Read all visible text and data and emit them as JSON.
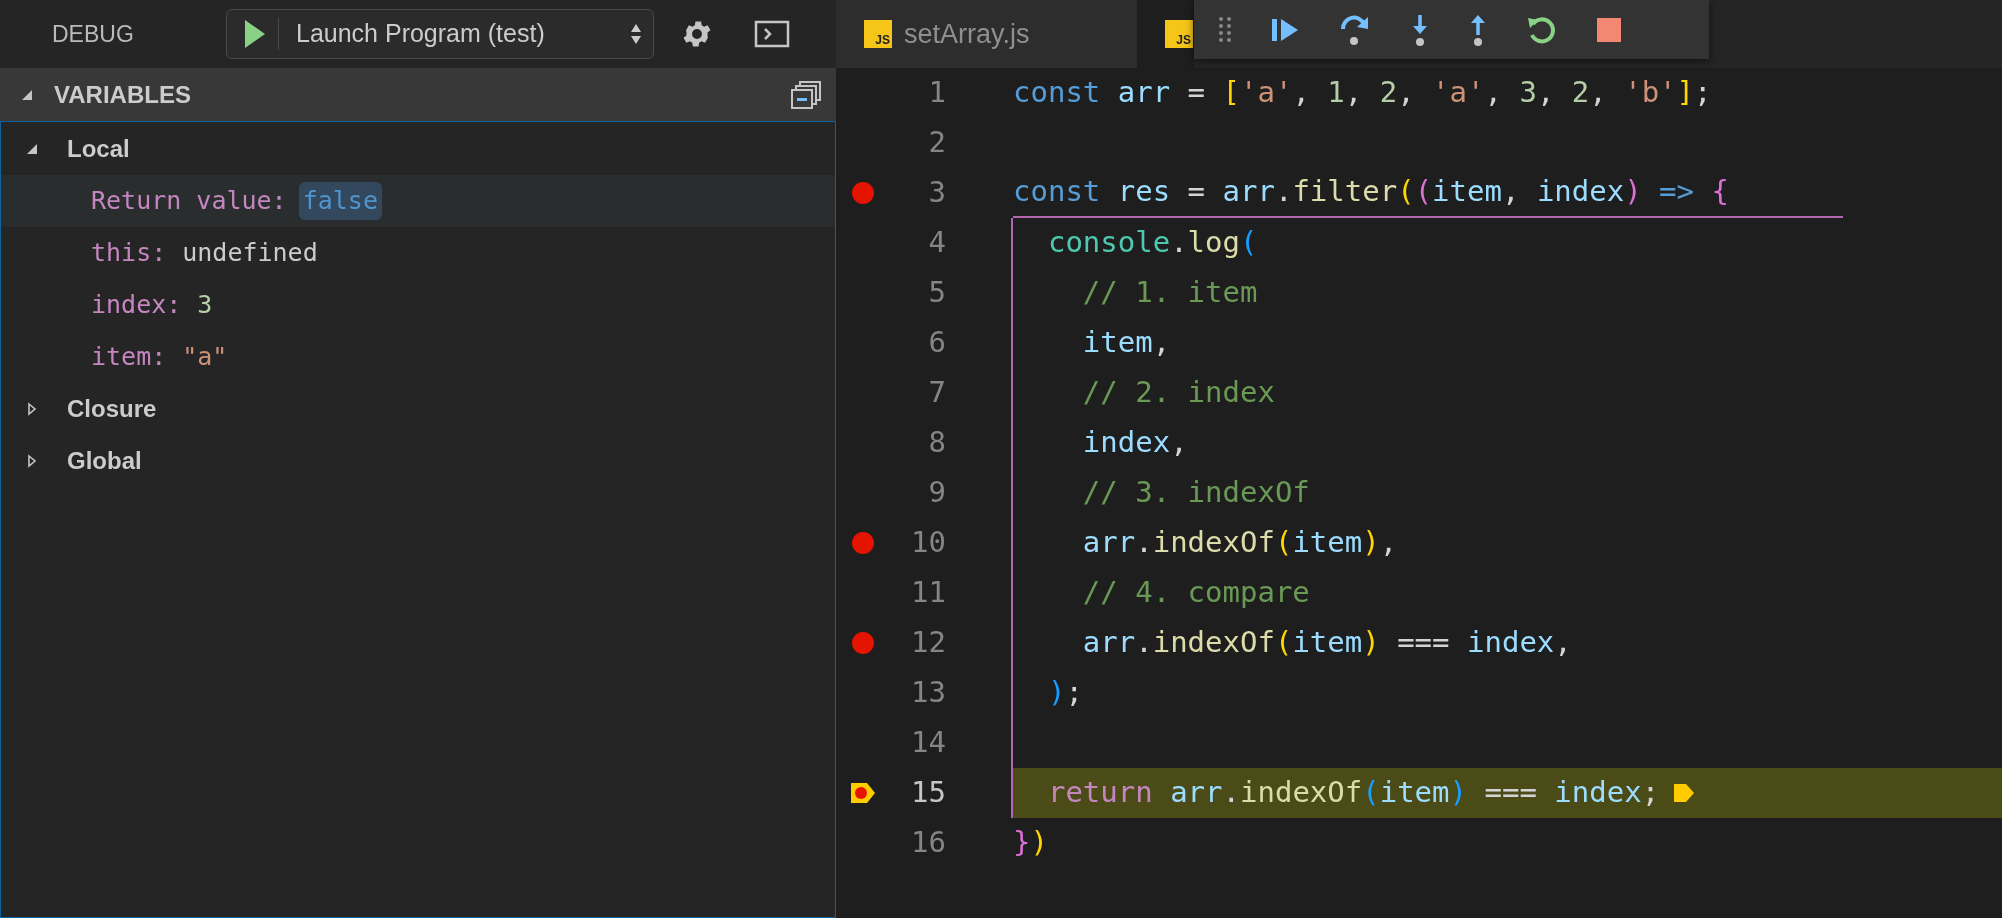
{
  "header": {
    "title": "DEBUG",
    "configuration": "Launch Program (test)"
  },
  "tabs": [
    {
      "label": "setArray.js",
      "icon_text": "JS",
      "selected": false
    },
    {
      "icon_text": "JS",
      "selected": true
    }
  ],
  "variables": {
    "title": "VARIABLES",
    "scopes": [
      {
        "label": "Local",
        "expanded": true,
        "children": [
          {
            "name": "Return value:",
            "value": "false",
            "kind": "boolean",
            "selected": true,
            "changed": true
          },
          {
            "name": "this:",
            "value": "undefined",
            "kind": "undefined",
            "selected": false,
            "changed": false
          },
          {
            "name": "index:",
            "value": "3",
            "kind": "number",
            "selected": false,
            "changed": false
          },
          {
            "name": "item:",
            "value": "\"a\"",
            "kind": "string",
            "selected": false,
            "changed": false
          }
        ]
      },
      {
        "label": "Closure",
        "expanded": false
      },
      {
        "label": "Global",
        "expanded": false
      }
    ]
  },
  "editor": {
    "lines": [
      {
        "number": "1",
        "breakpoint": false,
        "current": false,
        "tokens": [
          {
            "kind": "keyword",
            "text": "const"
          },
          {
            "kind": "variable",
            "text": " arr"
          },
          {
            "kind": "plain",
            "text": " = "
          },
          {
            "kind": "bracket1",
            "text": "["
          },
          {
            "kind": "string",
            "text": "'a'"
          },
          {
            "kind": "plain",
            "text": ", "
          },
          {
            "kind": "number",
            "text": "1"
          },
          {
            "kind": "plain",
            "text": ", "
          },
          {
            "kind": "number",
            "text": "2"
          },
          {
            "kind": "plain",
            "text": ", "
          },
          {
            "kind": "string",
            "text": "'a'"
          },
          {
            "kind": "plain",
            "text": ", "
          },
          {
            "kind": "number",
            "text": "3"
          },
          {
            "kind": "plain",
            "text": ", "
          },
          {
            "kind": "number",
            "text": "2"
          },
          {
            "kind": "plain",
            "text": ", "
          },
          {
            "kind": "string",
            "text": "'b'"
          },
          {
            "kind": "bracket1",
            "text": "]"
          },
          {
            "kind": "plain",
            "text": ";"
          }
        ]
      },
      {
        "number": "2",
        "breakpoint": false,
        "current": false
      },
      {
        "number": "3",
        "breakpoint": true,
        "current": false,
        "tokens": [
          {
            "kind": "keyword",
            "text": "const"
          },
          {
            "kind": "variable",
            "text": " res"
          },
          {
            "kind": "plain",
            "text": " = "
          },
          {
            "kind": "variable",
            "text": "arr"
          },
          {
            "kind": "plain",
            "text": "."
          },
          {
            "kind": "function",
            "text": "filter"
          },
          {
            "kind": "bracket1",
            "text": "("
          },
          {
            "kind": "bracket2",
            "text": "("
          },
          {
            "kind": "variable",
            "text": "item"
          },
          {
            "kind": "plain",
            "text": ", "
          },
          {
            "kind": "variable",
            "text": "index"
          },
          {
            "kind": "bracket2",
            "text": ")"
          },
          {
            "kind": "keyword",
            "text": " => "
          },
          {
            "kind": "bracket2",
            "text": "{"
          }
        ]
      },
      {
        "number": "4",
        "breakpoint": false,
        "current": false,
        "tokens": [
          {
            "kind": "class",
            "text": "  console"
          },
          {
            "kind": "plain",
            "text": "."
          },
          {
            "kind": "function",
            "text": "log"
          },
          {
            "kind": "bracket3",
            "text": "("
          }
        ]
      },
      {
        "number": "5",
        "breakpoint": false,
        "current": false,
        "tokens": [
          {
            "kind": "comment",
            "text": "    // 1. item"
          }
        ]
      },
      {
        "number": "6",
        "breakpoint": false,
        "current": false,
        "tokens": [
          {
            "kind": "variable",
            "text": "    item"
          },
          {
            "kind": "plain",
            "text": ","
          }
        ]
      },
      {
        "number": "7",
        "breakpoint": false,
        "current": false,
        "tokens": [
          {
            "kind": "comment",
            "text": "    // 2. index"
          }
        ]
      },
      {
        "number": "8",
        "breakpoint": false,
        "current": false,
        "tokens": [
          {
            "kind": "variable",
            "text": "    index"
          },
          {
            "kind": "plain",
            "text": ","
          }
        ]
      },
      {
        "number": "9",
        "breakpoint": false,
        "current": false,
        "tokens": [
          {
            "kind": "comment",
            "text": "    // 3. indexOf"
          }
        ]
      },
      {
        "number": "10",
        "breakpoint": true,
        "current": false,
        "tokens": [
          {
            "kind": "variable",
            "text": "    arr"
          },
          {
            "kind": "plain",
            "text": "."
          },
          {
            "kind": "function",
            "text": "indexOf"
          },
          {
            "kind": "bracket1",
            "text": "("
          },
          {
            "kind": "variable",
            "text": "item"
          },
          {
            "kind": "bracket1",
            "text": ")"
          },
          {
            "kind": "plain",
            "text": ","
          }
        ]
      },
      {
        "number": "11",
        "breakpoint": false,
        "current": false,
        "tokens": [
          {
            "kind": "comment",
            "text": "    // 4. compare"
          }
        ]
      },
      {
        "number": "12",
        "breakpoint": true,
        "current": false,
        "tokens": [
          {
            "kind": "variable",
            "text": "    arr"
          },
          {
            "kind": "plain",
            "text": "."
          },
          {
            "kind": "function",
            "text": "indexOf"
          },
          {
            "kind": "bracket1",
            "text": "("
          },
          {
            "kind": "variable",
            "text": "item"
          },
          {
            "kind": "bracket1",
            "text": ")"
          },
          {
            "kind": "plain",
            "text": " === "
          },
          {
            "kind": "variable",
            "text": "index"
          },
          {
            "kind": "plain",
            "text": ","
          }
        ]
      },
      {
        "number": "13",
        "breakpoint": false,
        "current": false,
        "tokens": [
          {
            "kind": "bracket3",
            "text": "  )"
          },
          {
            "kind": "plain",
            "text": ";"
          }
        ]
      },
      {
        "number": "14",
        "breakpoint": false,
        "current": false
      },
      {
        "number": "15",
        "breakpoint": true,
        "current": true,
        "tokens": [
          {
            "kind": "control",
            "text": "  return"
          },
          {
            "kind": "variable",
            "text": " arr"
          },
          {
            "kind": "plain",
            "text": "."
          },
          {
            "kind": "function",
            "text": "indexOf"
          },
          {
            "kind": "bracket3",
            "text": "("
          },
          {
            "kind": "variable",
            "text": "item"
          },
          {
            "kind": "bracket3",
            "text": ")"
          },
          {
            "kind": "plain",
            "text": " === "
          },
          {
            "kind": "variable",
            "text": "index"
          },
          {
            "kind": "plain",
            "text": ";"
          }
        ]
      },
      {
        "number": "16",
        "breakpoint": false,
        "current": false,
        "tokens": [
          {
            "kind": "bracket2",
            "text": "}"
          },
          {
            "kind": "bracket1",
            "text": ")"
          }
        ]
      }
    ]
  }
}
